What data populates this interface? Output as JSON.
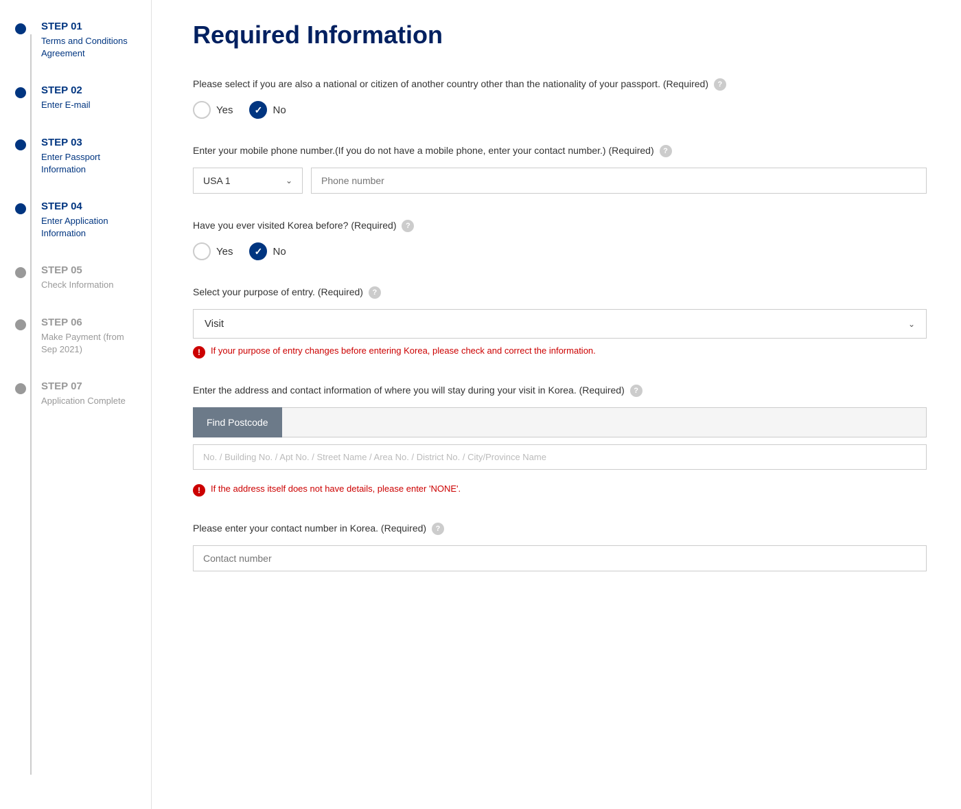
{
  "sidebar": {
    "steps": [
      {
        "id": "step01",
        "label": "STEP 01",
        "description": "Terms and Conditions Agreement",
        "active": true
      },
      {
        "id": "step02",
        "label": "STEP 02",
        "description": "Enter E-mail",
        "active": true
      },
      {
        "id": "step03",
        "label": "STEP 03",
        "description": "Enter Passport Information",
        "active": true
      },
      {
        "id": "step04",
        "label": "STEP 04",
        "description": "Enter Application Information",
        "active": true
      },
      {
        "id": "step05",
        "label": "STEP 05",
        "description": "Check Information",
        "active": false
      },
      {
        "id": "step06",
        "label": "STEP 06",
        "description": "Make Payment (from Sep 2021)",
        "active": false
      },
      {
        "id": "step07",
        "label": "STEP 07",
        "description": "Application Complete",
        "active": false
      }
    ]
  },
  "main": {
    "title": "Required Information",
    "nationality_question": "Please select if you are also a national or citizen of another country other than the nationality of your passport. (Required)",
    "nationality_yes": "Yes",
    "nationality_no": "No",
    "nationality_selected": "no",
    "phone_question": "Enter your mobile phone number.(If you do not have a mobile phone, enter your contact number.) (Required)",
    "phone_country": "USA 1",
    "phone_placeholder": "Phone number",
    "phone_value": "",
    "korea_visited_question": "Have you ever visited Korea before? (Required)",
    "korea_yes": "Yes",
    "korea_no": "No",
    "korea_selected": "no",
    "purpose_question": "Select your purpose of entry. (Required)",
    "purpose_value": "Visit",
    "purpose_warning": "If your purpose of entry changes before entering Korea, please check and correct the information.",
    "address_question": "Enter the address and contact information of where you will stay during your visit in Korea. (Required)",
    "find_postcode_label": "Find Postcode",
    "address_placeholder": "",
    "address_full_placeholder": "No. / Building No. / Apt No. / Street Name / Area No. / District No. / City/Province Name",
    "address_none_warning": "If the address itself does not have details, please enter 'NONE'.",
    "contact_korea_question": "Please enter your contact number in Korea. (Required)",
    "contact_korea_placeholder": "Contact number"
  }
}
